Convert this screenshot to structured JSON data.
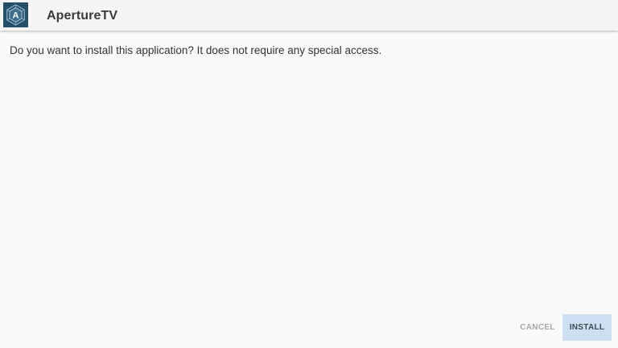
{
  "header": {
    "app_name": "ApertureTV",
    "icon": "aperture-tv-logo-icon",
    "icon_letter": "A"
  },
  "main": {
    "message": "Do you want to install this application? It does not require any special access."
  },
  "footer": {
    "cancel_label": "CANCEL",
    "install_label": "INSTALL"
  },
  "colors": {
    "background": "#fafafa",
    "header": "#f5f5f5",
    "icon_background": "#244e6a",
    "install_button": "#cddff0",
    "cancel_text": "#a6a6a6"
  }
}
